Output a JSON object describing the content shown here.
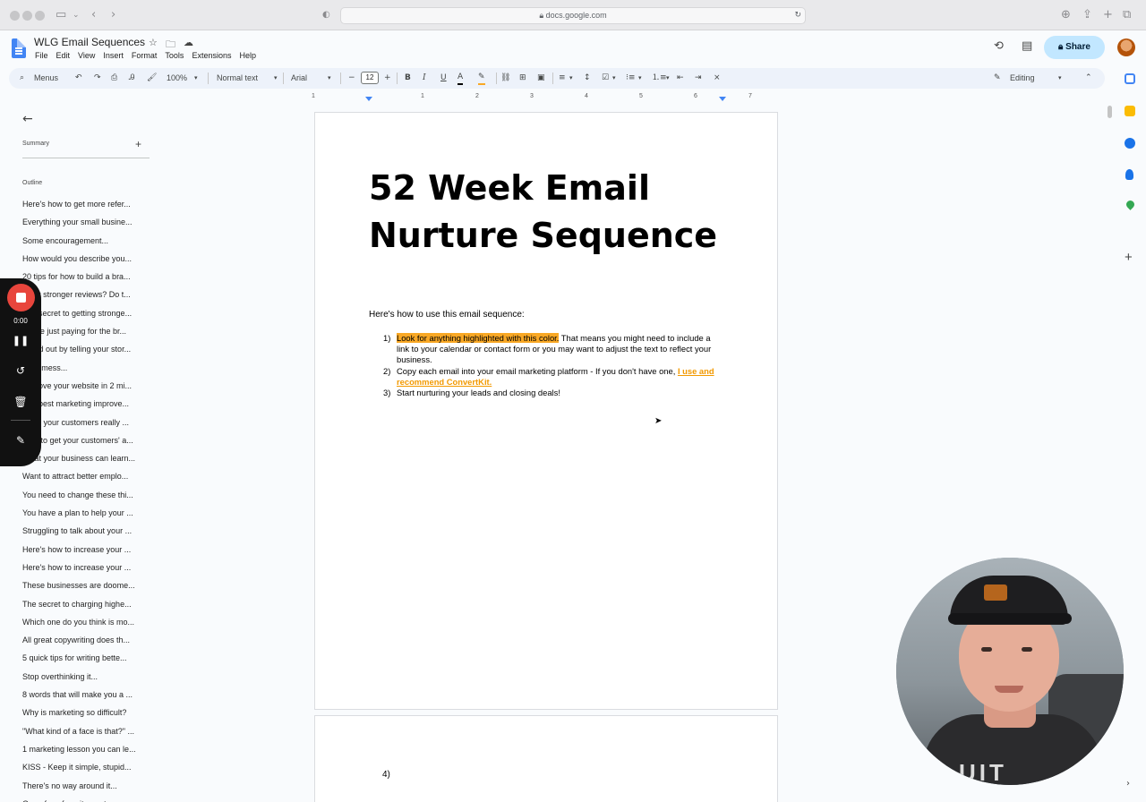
{
  "browser": {
    "url": "docs.google.com"
  },
  "document": {
    "title": "WLG Email Sequences",
    "menus": [
      "File",
      "Edit",
      "View",
      "Insert",
      "Format",
      "Tools",
      "Extensions",
      "Help"
    ],
    "share_label": "Share"
  },
  "toolbar": {
    "search_menus": "Menus",
    "zoom": "100%",
    "style": "Normal text",
    "font": "Arial",
    "font_size": "12",
    "mode": "Editing"
  },
  "ruler": {
    "numbers": [
      "1",
      "1",
      "2",
      "3",
      "4",
      "5",
      "6",
      "7"
    ]
  },
  "sidebar": {
    "summary_label": "Summary",
    "outline_label": "Outline",
    "items": [
      "Here's how to get more refer...",
      "Everything your small busine...",
      "Some encouragement...",
      "How would you describe you...",
      "20 tips for how to build a bra...",
      "Want stronger reviews? Do t...",
      "The secret to getting stronge...",
      "You're just paying for the br...",
      "Stand out by telling your stor...",
      "It's a mess...",
      "Improve your website in 2 mi...",
      "The best marketing improve...",
      "What your customers really ...",
      "How to get your customers' a...",
      "What your business can learn...",
      "Want to attract better emplo...",
      "You need to change these thi...",
      "You have a plan to help your ...",
      "Struggling to talk about your ...",
      "Here's how to increase your ...",
      "Here's how to increase your ...",
      "These businesses are doome...",
      "The secret to charging highe...",
      "Which one do you think is mo...",
      "All great copywriting does th...",
      "5 quick tips for writing bette...",
      "Stop overthinking it...",
      "8 words that will make you a ...",
      "Why is marketing so difficult?",
      "\"What kind of a face is that?\" ...",
      "1 marketing lesson you can le...",
      "KISS - Keep it simple, stupid...",
      "There's no way around it...",
      "One of my favorite quotes..."
    ]
  },
  "recorder": {
    "time": "0:00"
  },
  "page": {
    "heading": "52 Week Email Nurture Sequence",
    "intro": "Here's how to use this email sequence:",
    "steps": [
      {
        "num": "1)",
        "highlight": "Look for anything highlighted with this color.",
        "text": " That means you might need to include a link to your calendar or contact form or you may want to adjust the text to reflect your business."
      },
      {
        "num": "2)",
        "text": "Copy each email into your email marketing platform - If you don't have one, ",
        "link": "I use and recommend ConvertKit."
      },
      {
        "num": "3)",
        "text": "Start nurturing your leads and closing deals!"
      }
    ],
    "page2_number": "4)"
  },
  "colors": {
    "highlight": "#f9a825",
    "link": "#f29900",
    "share_bg": "#c2e7ff",
    "record": "#e8453c"
  }
}
